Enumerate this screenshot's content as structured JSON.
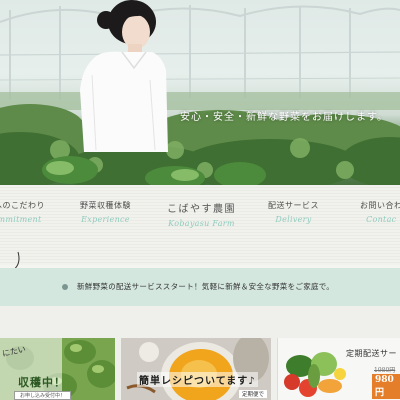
{
  "hero": {
    "tagline": "安心・安全・新鮮な野菜をお届けします。"
  },
  "nav": {
    "items": [
      {
        "ja": "へのこだわり",
        "en": "mmitment"
      },
      {
        "ja": "野菜収穫体験",
        "en": "Experience"
      },
      {
        "ja": "こばやす農園",
        "en": "Kobayasu Farm"
      },
      {
        "ja": "配送サービス",
        "en": "Delivery"
      },
      {
        "ja": "お問い合わ",
        "en": "Contac"
      }
    ]
  },
  "news": {
    "text": "新鮮野菜の配送サービススタート！気軽に新鮮＆安全な野菜をご家庭で。"
  },
  "banners": {
    "harvest": {
      "sub": "にたい",
      "title": "収穫中！",
      "button": "お申し込み受付中！"
    },
    "recipe": {
      "title": "簡単レシピついてます♪",
      "tag": "定期便で"
    },
    "subscription": {
      "title": "定期配送サー",
      "old_price": "1980円",
      "price": "980円"
    }
  },
  "colors": {
    "accent_text": "#8fcbbe",
    "news_bar": "#d4e7df",
    "price_badge": "#e47e2a"
  }
}
